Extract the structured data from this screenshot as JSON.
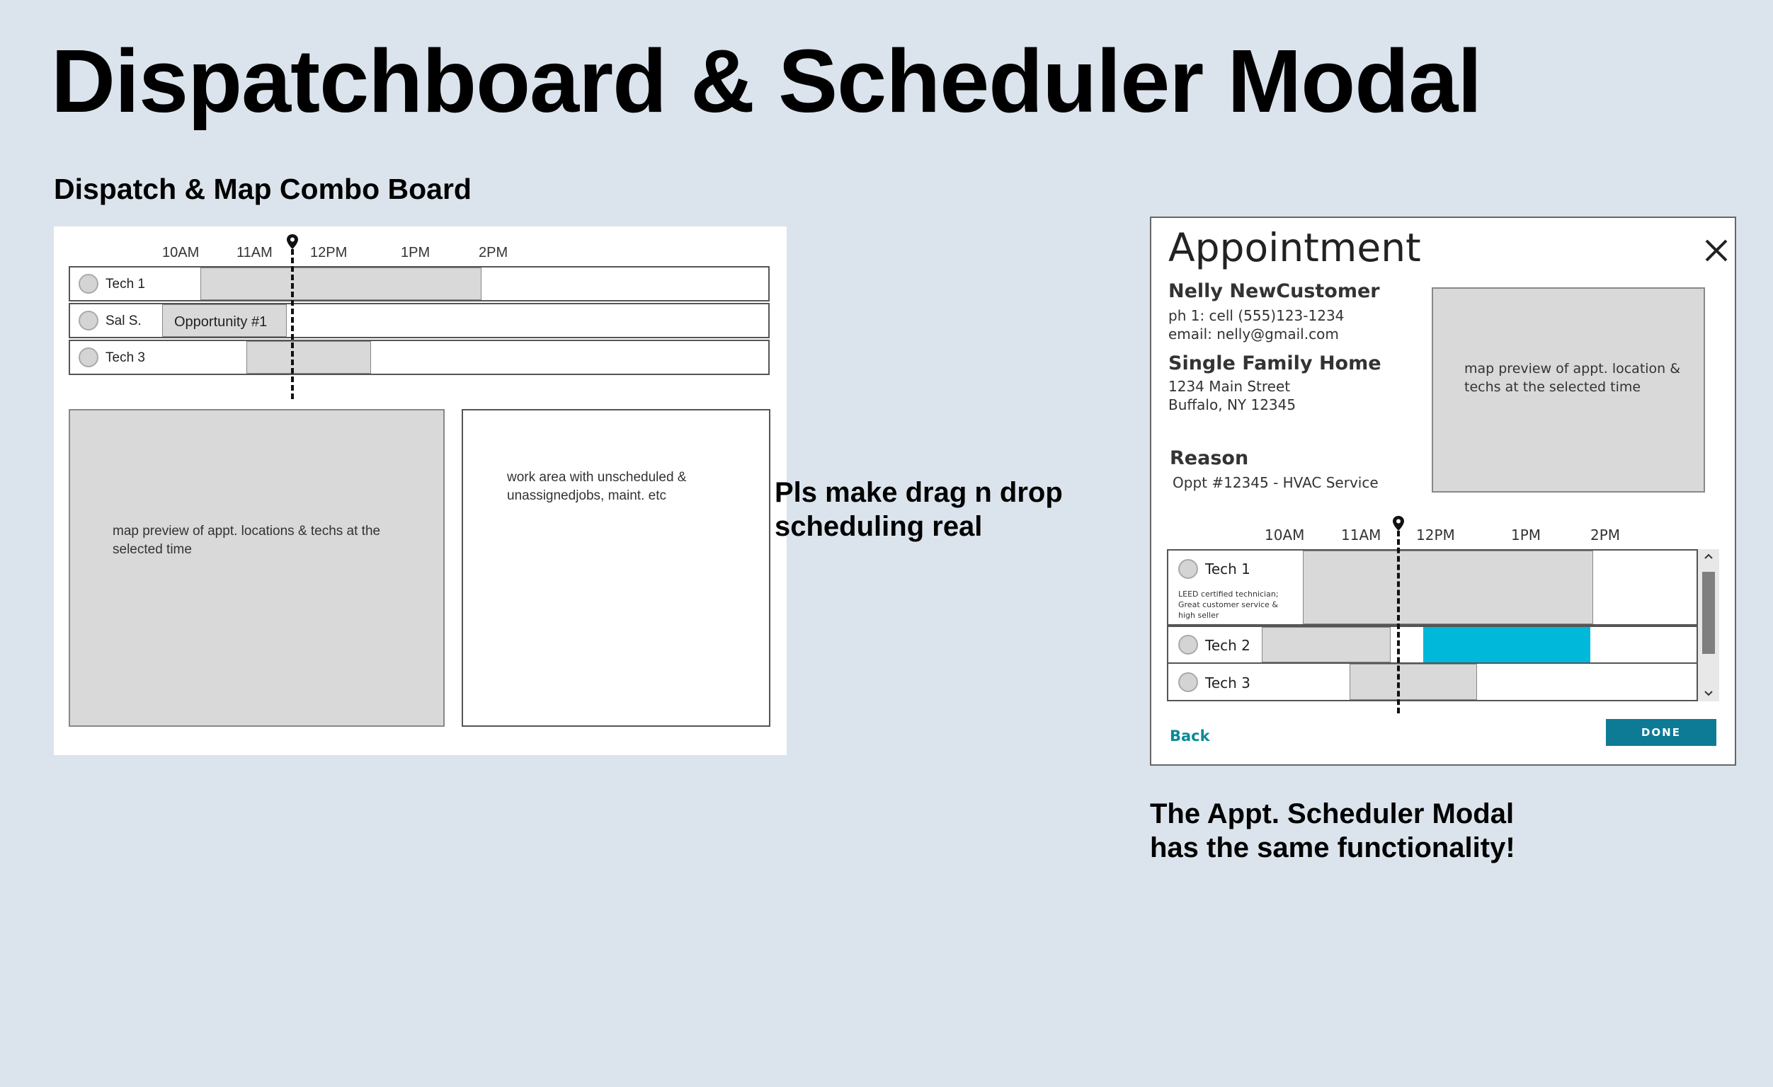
{
  "title": "Dispatchboard & Scheduler Modal",
  "board": {
    "heading": "Dispatch & Map Combo Board",
    "time_ticks": [
      "10AM",
      "11AM",
      "12PM",
      "1PM",
      "2PM"
    ],
    "rows": [
      {
        "name": "Tech 1"
      },
      {
        "name": "Sal S.",
        "block_label": "Opportunity #1"
      },
      {
        "name": "Tech 3"
      }
    ],
    "map_note": "map preview of appt. locations & techs at the selected time",
    "work_note": "work area with unscheduled & unassignedjobs, maint. etc"
  },
  "drag_note": [
    "Pls make drag n drop",
    "scheduling real"
  ],
  "modal": {
    "title": "Appointment",
    "customer": {
      "name": "Nelly NewCustomer",
      "phone": "ph 1: cell (555)123-1234",
      "email": "email: nelly@gmail.com"
    },
    "property": {
      "type": "Single Family Home",
      "address1": "1234 Main Street",
      "address2": "Buffalo, NY 12345"
    },
    "reason": {
      "label": "Reason",
      "value": "Oppt #12345 - HVAC Service"
    },
    "map_note": "map preview of appt. location & techs at the selected time",
    "time_ticks": [
      "10AM",
      "11AM",
      "12PM",
      "1PM",
      "2PM"
    ],
    "rows": [
      {
        "name": "Tech 1",
        "desc": [
          "LEED certified technician;",
          "Great customer service &",
          "high seller"
        ]
      },
      {
        "name": "Tech 2"
      },
      {
        "name": "Tech 3"
      }
    ],
    "back_label": "Back",
    "done_label": "DONE",
    "accent_color": "#00b8d9",
    "button_color": "#0d7a96"
  },
  "modal_note": [
    "The Appt. Scheduler Modal",
    "has the same functionality!"
  ]
}
